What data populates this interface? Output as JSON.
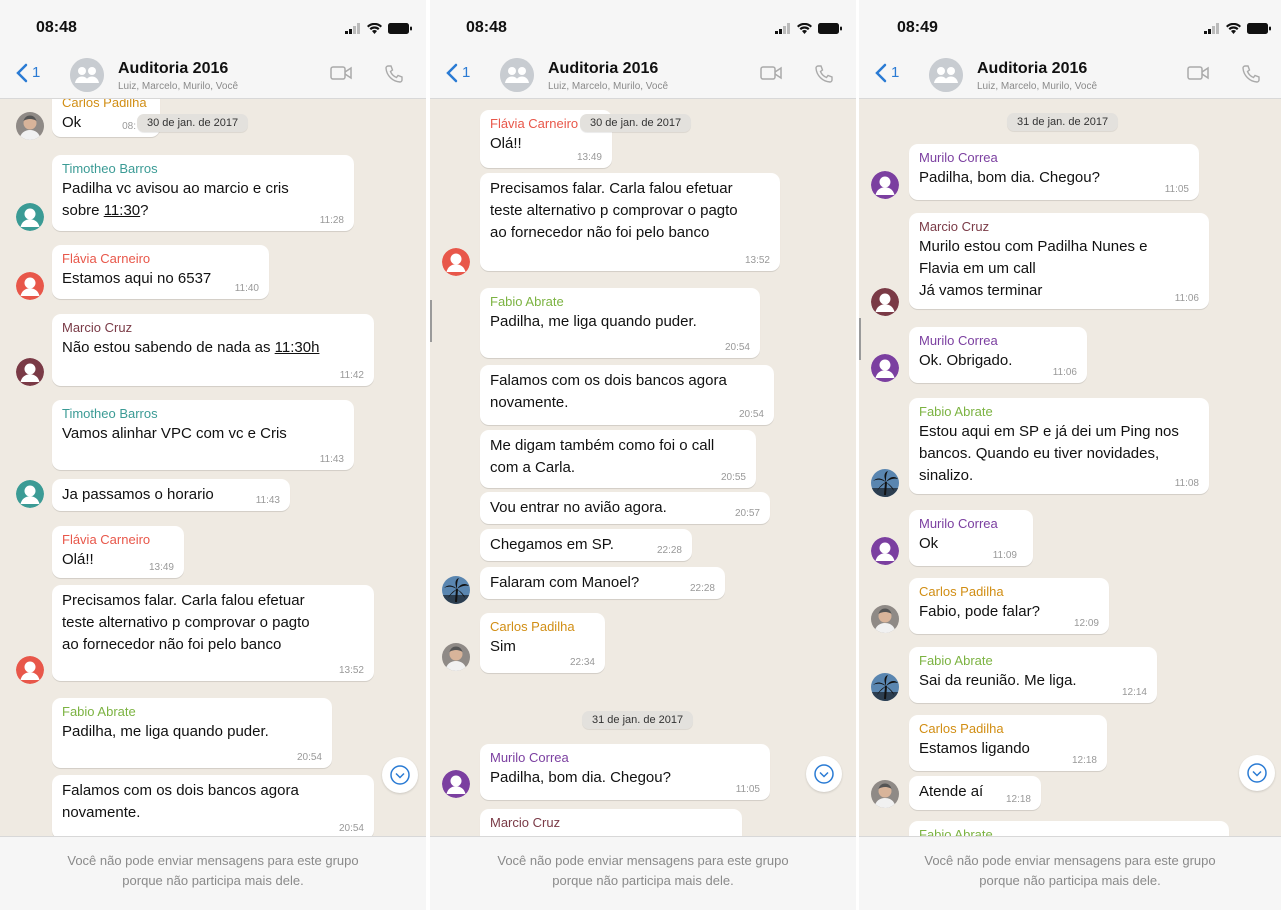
{
  "colors": {
    "carlos": "#d18e14",
    "timotheo": "#3b9b95",
    "flavia": "#e8574a",
    "marcio": "#7a3a46",
    "fabio": "#7cb342",
    "murilo": "#7b3fa0"
  },
  "screens": [
    {
      "time": "08:48",
      "back_count": "1",
      "group_title": "Auditoria 2016",
      "group_subtitle": "Luiz, Marcelo, Murilo, Você",
      "date_pill": "30 de jan. de 2017",
      "footer_line1": "Você não pode enviar mensagens para este grupo",
      "footer_line2": "porque não participa mais dele.",
      "messages": [
        {
          "sender": "Carlos Padilha",
          "text": "Ok",
          "time": "08:"
        },
        {
          "sender": "Timotheo Barros",
          "line1": "Padilha vc avisou ao marcio e cris",
          "line2_pre": "sobre ",
          "line2_link": "11:30",
          "line2_post": "?",
          "time": "11:28"
        },
        {
          "sender": "Flávia Carneiro",
          "text": "Estamos aqui no 6537",
          "time": "11:40"
        },
        {
          "sender": "Marcio Cruz",
          "text_pre": "Não estou sabendo de nada as ",
          "text_link": "11:30h",
          "time": "11:42"
        },
        {
          "sender": "Timotheo Barros",
          "text": "Vamos alinhar VPC com vc e Cris",
          "time": "11:43"
        },
        {
          "text": "Ja passamos o horario",
          "time": "11:43"
        },
        {
          "sender": "Flávia Carneiro",
          "text": "Olá!!",
          "time": "13:49"
        },
        {
          "line1": "Precisamos falar. Carla falou efetuar",
          "line2": "teste alternativo p comprovar o pagto",
          "line3": "ao fornecedor não foi pelo banco",
          "time": "13:52"
        },
        {
          "sender": "Fabio Abrate",
          "text": "Padilha, me liga quando puder.",
          "time": "20:54"
        },
        {
          "line1": "Falamos com os dois bancos agora",
          "line2": "novamente.",
          "time": "20:54"
        }
      ]
    },
    {
      "time": "08:48",
      "back_count": "1",
      "group_title": "Auditoria 2016",
      "group_subtitle": "Luiz, Marcelo, Murilo, Você",
      "date_pill": "30 de jan. de 2017",
      "date_pill_2": "31 de jan. de 2017",
      "footer_line1": "Você não pode enviar mensagens para este grupo",
      "footer_line2": "porque não participa mais dele.",
      "messages": [
        {
          "sender": "Flávia Carneiro",
          "text": "Olá!!",
          "time": "13:49"
        },
        {
          "line1": "Precisamos falar. Carla falou efetuar",
          "line2": "teste alternativo p comprovar o pagto",
          "line3": "ao fornecedor não foi pelo banco",
          "time": "13:52"
        },
        {
          "sender": "Fabio Abrate",
          "text": "Padilha, me liga quando puder.",
          "time": "20:54"
        },
        {
          "line1": "Falamos com os dois bancos agora",
          "line2": "novamente.",
          "time": "20:54"
        },
        {
          "line1": "Me digam também como foi o call",
          "line2": "com a Carla.",
          "time": "20:55"
        },
        {
          "text": "Vou entrar no avião agora.",
          "time": "20:57"
        },
        {
          "text": "Chegamos em SP.",
          "time": "22:28"
        },
        {
          "text": "Falaram com Manoel?",
          "time": "22:28"
        },
        {
          "sender": "Carlos Padilha",
          "text": "Sim",
          "time": "22:34"
        },
        {
          "sender": "Murilo Correa",
          "text": "Padilha, bom dia. Chegou?",
          "time": "11:05"
        },
        {
          "sender": "Marcio Cruz"
        }
      ]
    },
    {
      "time": "08:49",
      "back_count": "1",
      "group_title": "Auditoria 2016",
      "group_subtitle": "Luiz, Marcelo, Murilo, Você",
      "date_pill": "31 de jan. de 2017",
      "footer_line1": "Você não pode enviar mensagens para este grupo",
      "footer_line2": "porque não participa mais dele.",
      "messages": [
        {
          "sender": "Murilo Correa",
          "text": "Padilha, bom dia. Chegou?",
          "time": "11:05"
        },
        {
          "sender": "Marcio Cruz",
          "line1": "Murilo estou com Padilha Nunes e",
          "line2": "Flavia em um call",
          "line3": "Já vamos terminar",
          "time": "11:06"
        },
        {
          "sender": "Murilo Correa",
          "text": "Ok. Obrigado.",
          "time": "11:06"
        },
        {
          "sender": "Fabio Abrate",
          "line1": "Estou aqui em SP e já dei um Ping nos",
          "line2": "bancos. Quando eu tiver novidades,",
          "line3": "sinalizo.",
          "time": "11:08"
        },
        {
          "sender": "Murilo Correa",
          "text": "Ok",
          "time": "11:09"
        },
        {
          "sender": "Carlos Padilha",
          "text": "Fabio, pode falar?",
          "time": "12:09"
        },
        {
          "sender": "Fabio Abrate",
          "text": "Sai da reunião. Me liga.",
          "time": "12:14"
        },
        {
          "sender": "Carlos Padilha",
          "text": "Estamos ligando",
          "time": "12:18"
        },
        {
          "text": "Atende aí",
          "time": "12:18"
        },
        {
          "sender": "Fabio Abrate"
        }
      ]
    }
  ]
}
